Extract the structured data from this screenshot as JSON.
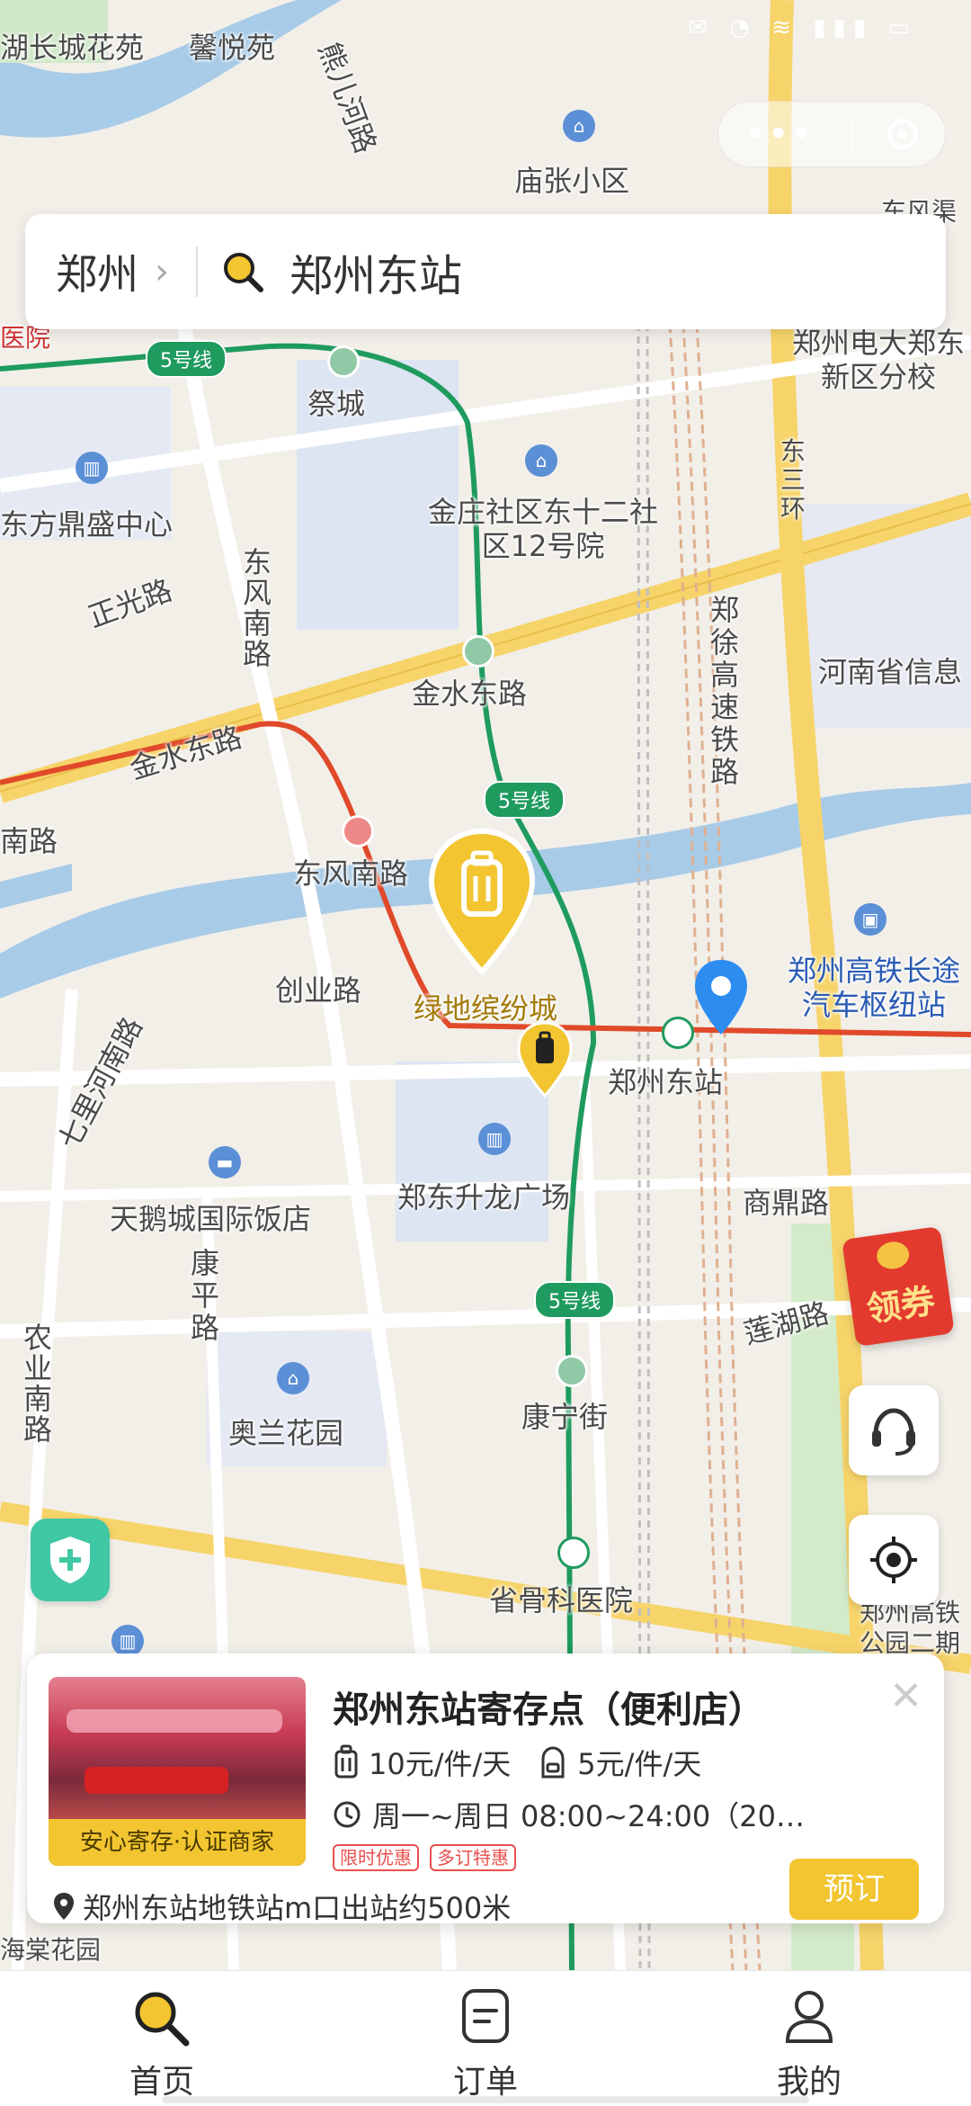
{
  "search": {
    "city": "郑州",
    "query": "郑州东站"
  },
  "map_labels": {
    "top_left_1": "湖长城花苑",
    "top_left_2": "馨悦苑",
    "river_road": "熊儿河路",
    "miaozhang": "庙张小区",
    "dongfeng_qu": "东风渠",
    "hospital": "医院",
    "line5_a": "5号线",
    "line5_b": "5号线",
    "line5_c": "5号线",
    "jicheng": "祭城",
    "dianda": "郑州电大郑东新区分校",
    "dongfang": "东方鼎盛中心",
    "jinzhuang": "金庄社区东十二社区12号院",
    "dongsanhuan": "东三环",
    "zhengguang": "正光路",
    "dongfengnan_v": "东风南路",
    "zhengxu": "郑徐高速铁路",
    "henan_info": "河南省信息",
    "jinshui_station": "金水东路",
    "jinshui_road": "金水东路",
    "nan_road": "南路",
    "dongfengnan_station": "东风南路",
    "greenland": "绿地缤纷城",
    "bus_hub": "郑州高铁长途汽车枢纽站",
    "chuangye": "创业路",
    "qili_road": "七里河南路",
    "zhengzhou_east": "郑州东站",
    "shengding": "商鼎路",
    "shenglong": "郑东升龙广场",
    "swan_hotel": "天鹅城国际饭店",
    "kangping": "康平路",
    "lianhu": "莲湖路",
    "nongye": "农业南路",
    "aolan": "奥兰花园",
    "kangning": "康宁街",
    "gugu": "省骨科医院",
    "right_edge": "郑州高铁公园二期",
    "bottom_left": "海棠花园"
  },
  "coupon_label": "领券",
  "store": {
    "name": "郑州东站寄存点（便利店）",
    "badge": "安心寄存·认证商家",
    "price_large": "10元/件/天",
    "price_small": "5元/件/天",
    "hours": "周一~周日 08:00~24:00（20…",
    "tags": [
      "限时优惠",
      "多订特惠"
    ],
    "address": "郑州东站地铁站m口出站约500米",
    "book": "预订"
  },
  "tabs": [
    {
      "label": "首页",
      "icon": "search-icon",
      "active": true
    },
    {
      "label": "订单",
      "icon": "order-icon",
      "active": false
    },
    {
      "label": "我的",
      "icon": "profile-icon",
      "active": false
    }
  ],
  "colors": {
    "accent": "#f2c531",
    "metro_line5": "#1f9b5f",
    "metro_red": "#e04a2a",
    "road_major": "#f7d46a",
    "water": "#a8cbe8"
  }
}
